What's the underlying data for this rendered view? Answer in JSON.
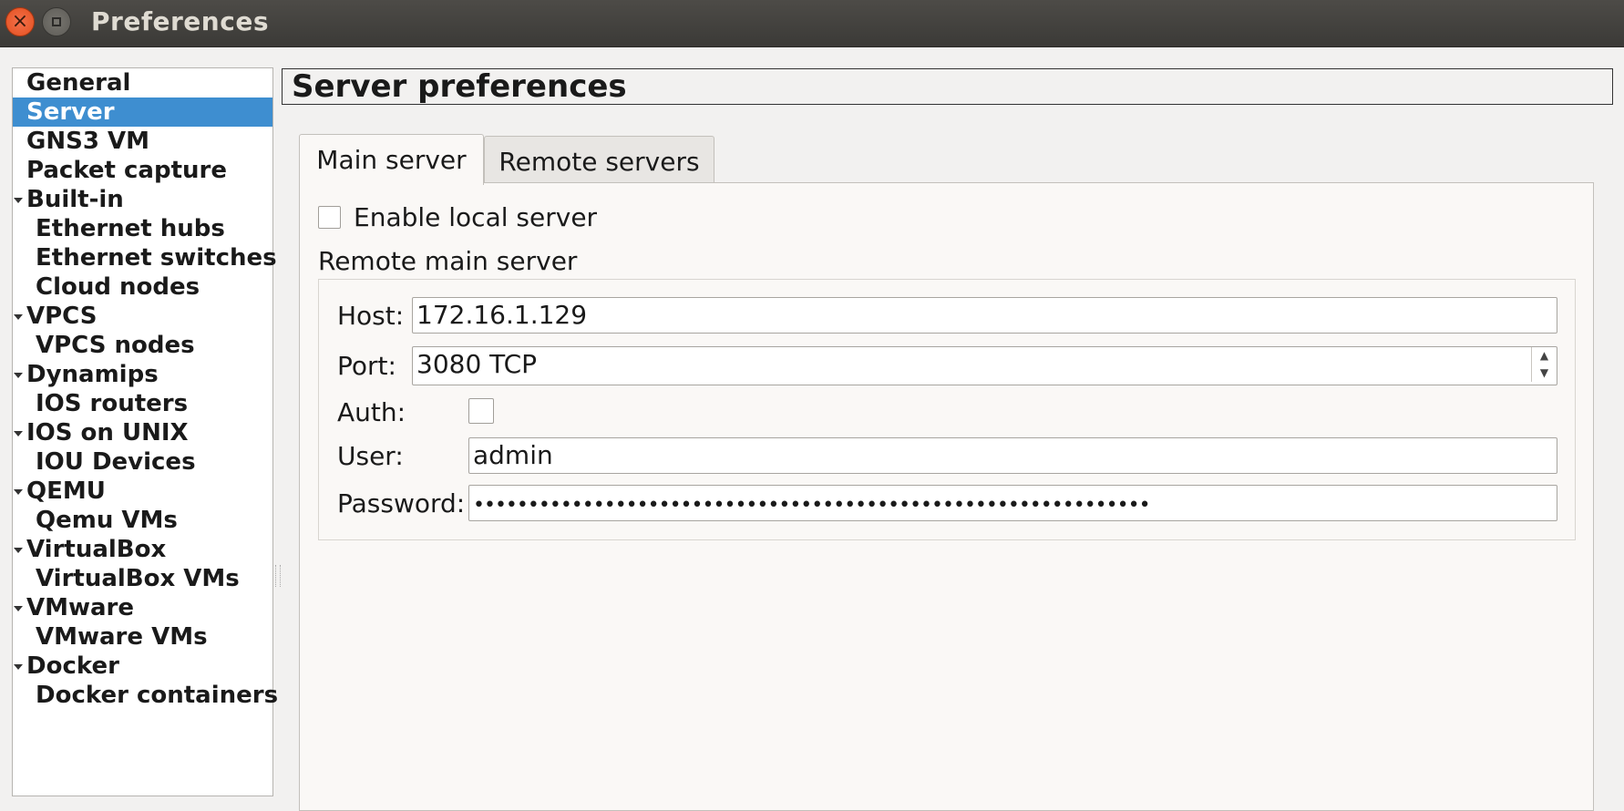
{
  "window": {
    "title": "Preferences"
  },
  "sidebar": {
    "items": [
      {
        "label": "General",
        "level": 0,
        "expandable": false,
        "selected": false
      },
      {
        "label": "Server",
        "level": 0,
        "expandable": false,
        "selected": true
      },
      {
        "label": "GNS3 VM",
        "level": 0,
        "expandable": false,
        "selected": false
      },
      {
        "label": "Packet capture",
        "level": 0,
        "expandable": false,
        "selected": false
      },
      {
        "label": "Built-in",
        "level": 0,
        "expandable": true,
        "selected": false
      },
      {
        "label": "Ethernet hubs",
        "level": 1,
        "expandable": false,
        "selected": false
      },
      {
        "label": "Ethernet switches",
        "level": 1,
        "expandable": false,
        "selected": false
      },
      {
        "label": "Cloud nodes",
        "level": 1,
        "expandable": false,
        "selected": false
      },
      {
        "label": "VPCS",
        "level": 0,
        "expandable": true,
        "selected": false
      },
      {
        "label": "VPCS nodes",
        "level": 1,
        "expandable": false,
        "selected": false
      },
      {
        "label": "Dynamips",
        "level": 0,
        "expandable": true,
        "selected": false
      },
      {
        "label": "IOS routers",
        "level": 1,
        "expandable": false,
        "selected": false
      },
      {
        "label": "IOS on UNIX",
        "level": 0,
        "expandable": true,
        "selected": false
      },
      {
        "label": "IOU Devices",
        "level": 1,
        "expandable": false,
        "selected": false
      },
      {
        "label": "QEMU",
        "level": 0,
        "expandable": true,
        "selected": false
      },
      {
        "label": "Qemu VMs",
        "level": 1,
        "expandable": false,
        "selected": false
      },
      {
        "label": "VirtualBox",
        "level": 0,
        "expandable": true,
        "selected": false
      },
      {
        "label": "VirtualBox VMs",
        "level": 1,
        "expandable": false,
        "selected": false
      },
      {
        "label": "VMware",
        "level": 0,
        "expandable": true,
        "selected": false
      },
      {
        "label": "VMware VMs",
        "level": 1,
        "expandable": false,
        "selected": false
      },
      {
        "label": "Docker",
        "level": 0,
        "expandable": true,
        "selected": false
      },
      {
        "label": "Docker containers",
        "level": 1,
        "expandable": false,
        "selected": false
      }
    ]
  },
  "main": {
    "header": "Server preferences",
    "tabs": [
      {
        "label": "Main server",
        "active": true
      },
      {
        "label": "Remote servers",
        "active": false
      }
    ],
    "enable_local_server": {
      "label": "Enable local server",
      "checked": false
    },
    "group_title": "Remote main server",
    "host": {
      "label": "Host:",
      "value": "172.16.1.129"
    },
    "port": {
      "label": "Port:",
      "value": "3080 TCP"
    },
    "auth": {
      "label": "Auth:",
      "checked": false
    },
    "user": {
      "label": "User:",
      "value": "admin"
    },
    "password": {
      "label": "Password:",
      "value": "••••••••••••••••••••••••••••••••••••••••••••••••••••••••••••••"
    }
  },
  "colors": {
    "selection": "#3e8ed0",
    "close_button": "#e95420",
    "titlebar": "#3f3e3a"
  }
}
